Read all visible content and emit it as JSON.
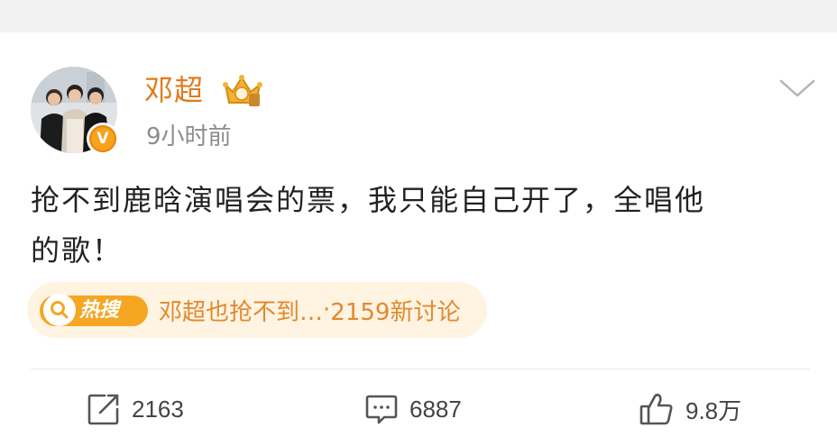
{
  "post": {
    "author": {
      "name": "邓超",
      "avatar_icon": "avatar-photo",
      "verified_badge": "V",
      "member_icon": "crown-icon"
    },
    "timestamp": "9小时前",
    "text_line1": "抢不到鹿晗演唱会的票，我只能自己开了，全唱他",
    "text_line2": "的歌！",
    "hot_search": {
      "tag_label": "热搜",
      "topic": "邓超也抢不到…",
      "separator": "·",
      "discussion": "2159新讨论"
    },
    "actions": {
      "repost_count": "2163",
      "comment_count": "6887",
      "like_count": "9.8万"
    }
  },
  "colors": {
    "username": "#e27a1a",
    "hot_chip_bg": "#fff3e2",
    "hot_text": "#e0892e",
    "badge": "#f7a21b"
  }
}
